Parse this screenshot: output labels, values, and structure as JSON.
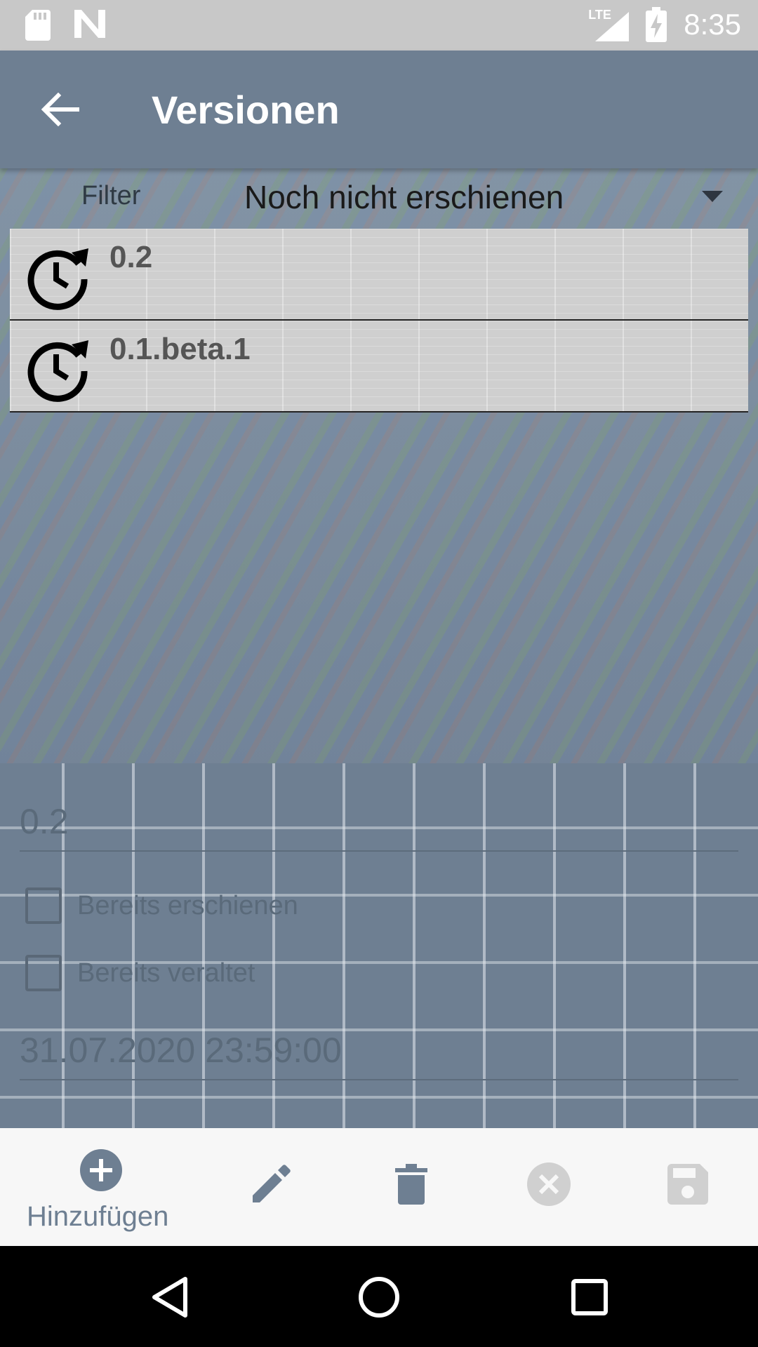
{
  "status_bar": {
    "network": "LTE",
    "time": "8:35"
  },
  "app_bar": {
    "title": "Versionen"
  },
  "filter": {
    "label": "Filter",
    "selected": "Noch nicht erschienen"
  },
  "versions": [
    {
      "label": "0.2"
    },
    {
      "label": "0.1.beta.1"
    }
  ],
  "detail": {
    "version_value": "0.2",
    "released_label": "Bereits erschienen",
    "deprecated_label": "Bereits veraltet",
    "date_value": "31.07.2020 23:59:00"
  },
  "toolbar": {
    "add_label": "Hinzufügen"
  },
  "icons": {
    "back": "arrow-back-icon",
    "version": "clock-update-icon",
    "add": "plus-circle-icon",
    "edit": "pencil-icon",
    "delete": "trash-icon",
    "cancel": "close-circle-icon",
    "save": "floppy-disk-icon"
  },
  "colors": {
    "primary": "#6e7f92",
    "toolbar_bg": "#f7f7f7",
    "list_item_bg": "#cfcfcf",
    "disabled_icon": "#d0d0d0"
  }
}
